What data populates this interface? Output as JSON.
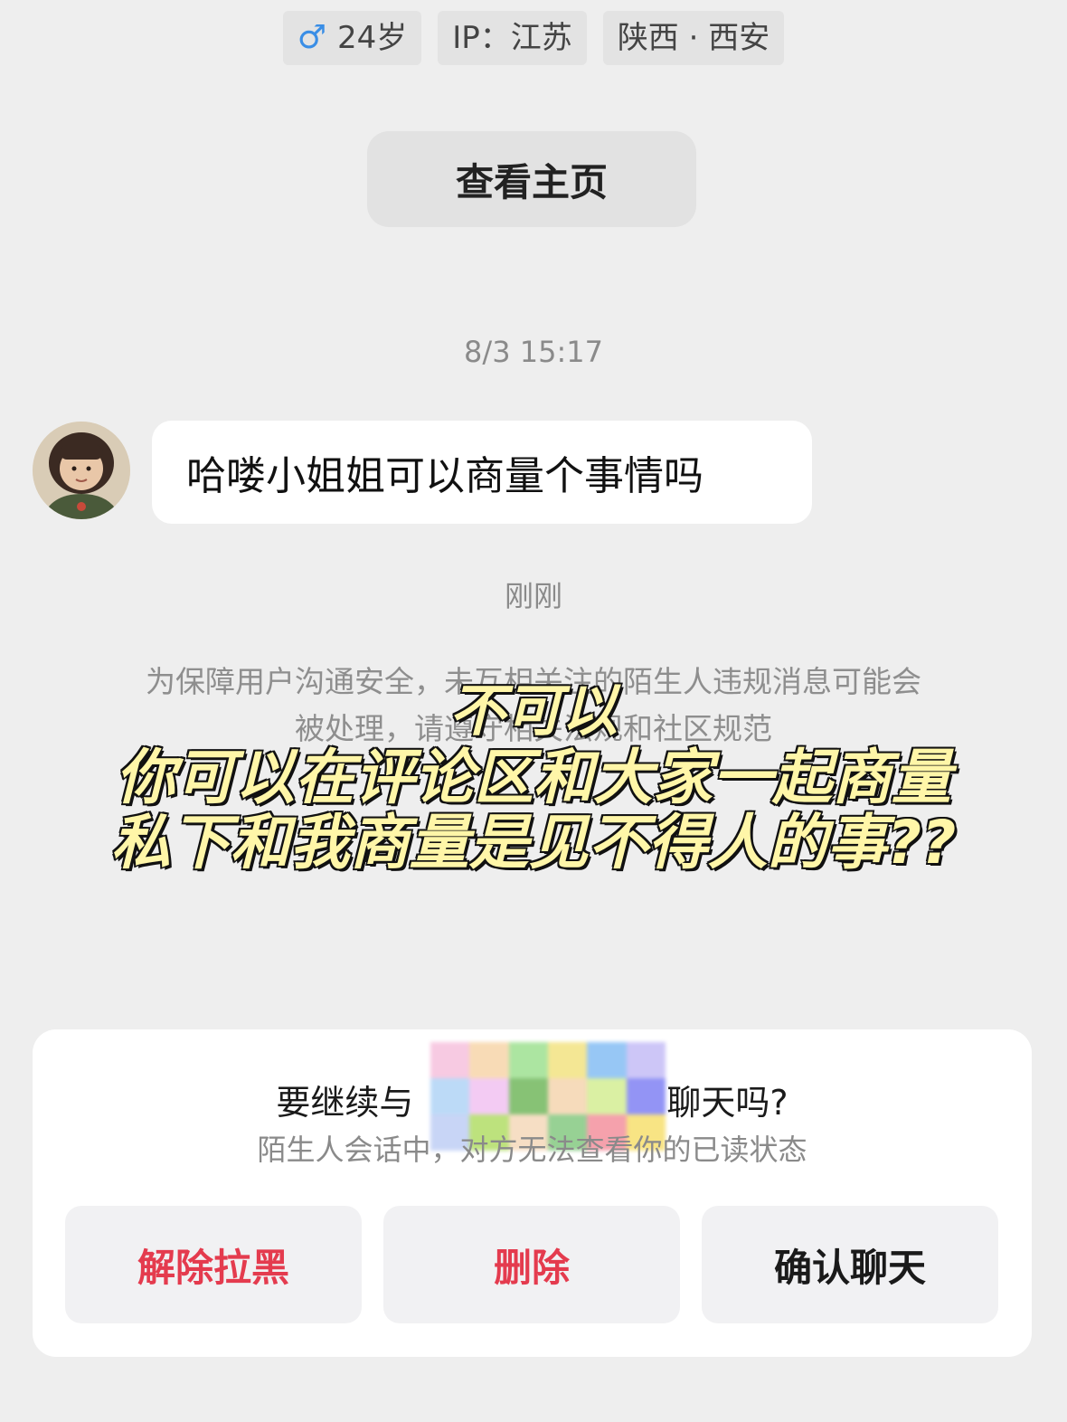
{
  "profile_tags": {
    "age": "24岁",
    "ip": "IP：江苏",
    "location": "陕西 · 西安"
  },
  "homepage_button": "查看主页",
  "chat": {
    "timestamp1": "8/3 15:17",
    "message": "哈喽小姐姐可以商量个事情吗",
    "timestamp2": "刚刚",
    "notice": "为保障用户沟通安全，未互相关注的陌生人违规消息可能会被处理，请遵守相关法规和社区规范"
  },
  "overlay_caption": {
    "line1": "不可以",
    "line2": "你可以在评论区和大家一起商量",
    "line3": "私下和我商量是见不得人的事??"
  },
  "dialog": {
    "question_prefix": "要继续与",
    "question_suffix": "聊天吗?",
    "subtitle": "陌生人会话中，对方无法查看你的已读状态",
    "unblock": "解除拉黑",
    "delete": "删除",
    "confirm": "确认聊天"
  },
  "colors": {
    "male_icon": "#3a8ee6",
    "danger": "#e43b4e",
    "caption_fill": "#fff6a8"
  }
}
